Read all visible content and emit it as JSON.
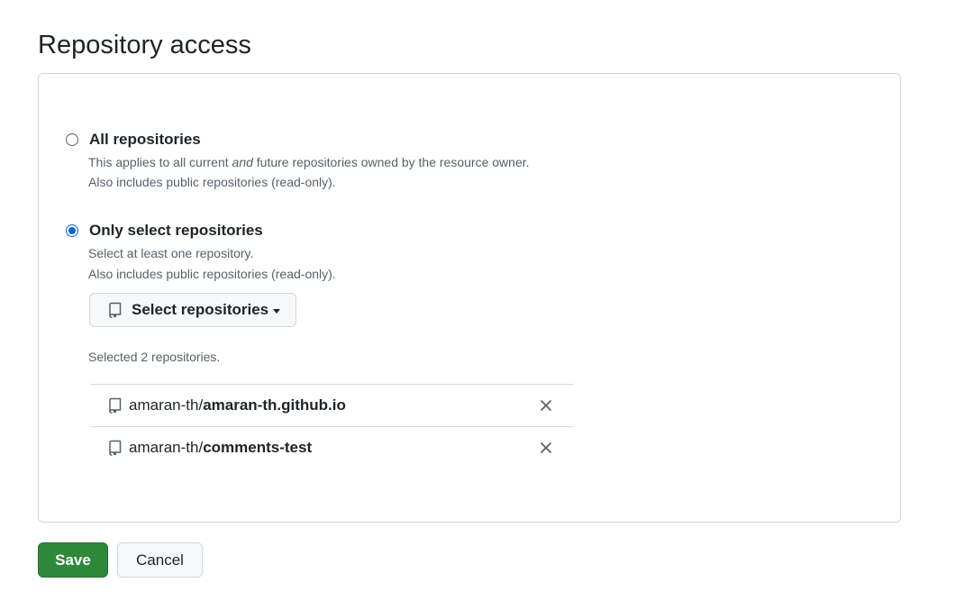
{
  "page": {
    "title": "Repository access"
  },
  "options": {
    "all": {
      "label": "All repositories",
      "checked": false,
      "note_prefix": "This applies to all current ",
      "note_emphasis": "and",
      "note_suffix": " future repositories owned by the resource owner.",
      "note_line2": "Also includes public repositories (read-only)."
    },
    "select": {
      "label": "Only select repositories",
      "checked": true,
      "note_line1": "Select at least one repository.",
      "note_line2": "Also includes public repositories (read-only).",
      "button_label": "Select repositories",
      "button_icon": "repo-icon",
      "selected_summary": "Selected 2 repositories."
    }
  },
  "repositories": [
    {
      "owner": "amaran-th/",
      "name": "amaran-th.github.io",
      "icon": "repo-icon",
      "remove_icon": "x-icon"
    },
    {
      "owner": "amaran-th/",
      "name": "comments-test",
      "icon": "repo-icon",
      "remove_icon": "x-icon"
    }
  ],
  "actions": {
    "save_label": "Save",
    "cancel_label": "Cancel"
  },
  "colors": {
    "accent": "#0969da",
    "save_button": "#2e883a",
    "border": "#d0d7de",
    "muted_text": "#57606a"
  }
}
